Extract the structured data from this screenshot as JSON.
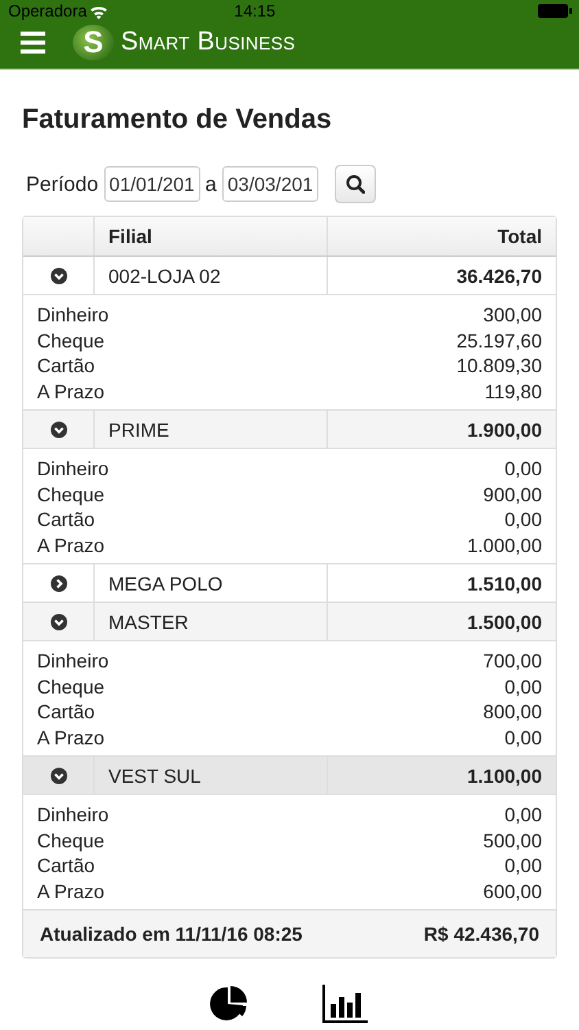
{
  "status_bar": {
    "carrier": "Operadora",
    "time": "14:15"
  },
  "header": {
    "brand": "Smart Business",
    "brand_initial": "S"
  },
  "title": "Faturamento de Vendas",
  "period": {
    "label": "Período",
    "start": "01/01/201",
    "separator": "a",
    "end": "03/03/201"
  },
  "table": {
    "columns": [
      "Filial",
      "Total"
    ],
    "groups": [
      {
        "name": "002-LOJA 02",
        "total": "36.426,70",
        "expanded": true,
        "selected": false,
        "details": [
          {
            "label": "Dinheiro",
            "value": "300,00"
          },
          {
            "label": "Cheque",
            "value": "25.197,60"
          },
          {
            "label": "Cartão",
            "value": "10.809,30"
          },
          {
            "label": "A Prazo",
            "value": "119,80"
          }
        ]
      },
      {
        "name": "PRIME",
        "total": "1.900,00",
        "expanded": true,
        "selected": false,
        "details": [
          {
            "label": "Dinheiro",
            "value": "0,00"
          },
          {
            "label": "Cheque",
            "value": "900,00"
          },
          {
            "label": "Cartão",
            "value": "0,00"
          },
          {
            "label": "A Prazo",
            "value": "1.000,00"
          }
        ]
      },
      {
        "name": "MEGA POLO",
        "total": "1.510,00",
        "expanded": false,
        "selected": false
      },
      {
        "name": "MASTER",
        "total": "1.500,00",
        "expanded": true,
        "selected": false,
        "details": [
          {
            "label": "Dinheiro",
            "value": "700,00"
          },
          {
            "label": "Cheque",
            "value": "0,00"
          },
          {
            "label": "Cartão",
            "value": "800,00"
          },
          {
            "label": "A Prazo",
            "value": "0,00"
          }
        ]
      },
      {
        "name": "VEST SUL",
        "total": "1.100,00",
        "expanded": true,
        "selected": true,
        "details": [
          {
            "label": "Dinheiro",
            "value": "0,00"
          },
          {
            "label": "Cheque",
            "value": "500,00"
          },
          {
            "label": "Cartão",
            "value": "0,00"
          },
          {
            "label": "A Prazo",
            "value": "600,00"
          }
        ]
      }
    ],
    "footer": {
      "updated": "Atualizado em 11/11/16 08:25",
      "total": "R$ 42.436,70"
    }
  }
}
